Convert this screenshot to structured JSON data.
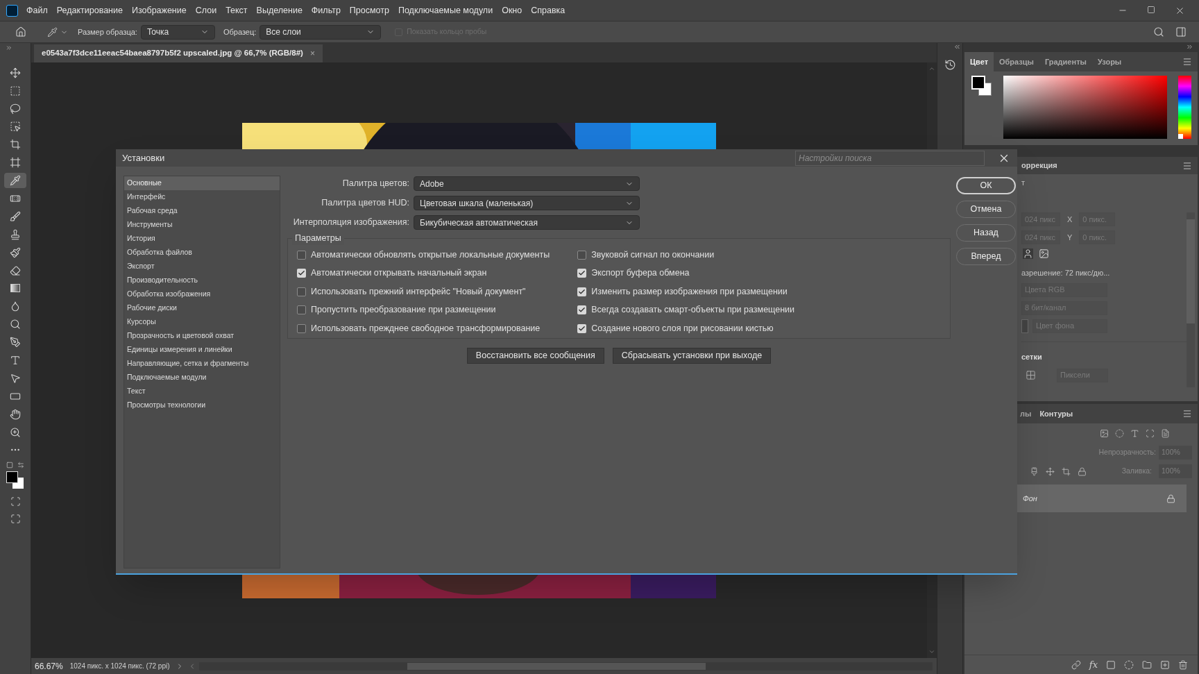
{
  "menu_bar": {
    "items": [
      "Файл",
      "Редактирование",
      "Изображение",
      "Слои",
      "Текст",
      "Выделение",
      "Фильтр",
      "Просмотр",
      "Подключаемые модули",
      "Окно",
      "Справка"
    ]
  },
  "options_bar": {
    "sample_size_label": "Размер образца:",
    "sample_size": "Точка",
    "sample_label": "Образец:",
    "sample": "Все слои",
    "show_ring": {
      "label": "Показать кольцо пробы",
      "checked": false,
      "disabled": true
    }
  },
  "tools": [
    {
      "kind": "move",
      "selected": false
    },
    {
      "kind": "marquee",
      "selected": false
    },
    {
      "kind": "lasso",
      "selected": false
    },
    {
      "kind": "object_select",
      "selected": false
    },
    {
      "kind": "crop",
      "selected": false
    },
    {
      "kind": "frame",
      "selected": false
    },
    {
      "kind": "eyedropper",
      "selected": true
    },
    {
      "kind": "healing",
      "selected": false
    },
    {
      "kind": "brush",
      "selected": false
    },
    {
      "kind": "stamp",
      "selected": false
    },
    {
      "kind": "history_brush",
      "selected": false
    },
    {
      "kind": "eraser",
      "selected": false
    },
    {
      "kind": "gradient",
      "selected": false
    },
    {
      "kind": "blur",
      "selected": false
    },
    {
      "kind": "dodge",
      "selected": false
    },
    {
      "kind": "pen",
      "selected": false
    },
    {
      "kind": "type",
      "selected": false
    },
    {
      "kind": "path_select",
      "selected": false
    },
    {
      "kind": "shape",
      "selected": false
    },
    {
      "kind": "hand",
      "selected": false
    },
    {
      "kind": "zoom",
      "selected": false
    },
    {
      "kind": "more",
      "selected": false
    }
  ],
  "document": {
    "tab_title": "e0543a7f3dce11eeac54baea8797b5f2 upscaled.jpg @ 66,7% (RGB/8#)",
    "close": "×",
    "zoom": "66.67%",
    "info": "1024 пикс. x 1024 пикс. (72 ppi)"
  },
  "panels": {
    "color": {
      "hue": {
        "level": 0
      },
      "tabs": [
        {
          "label": "Цвет",
          "selected": true
        },
        {
          "label": "Образцы",
          "selected": false
        },
        {
          "label": "Градиенты",
          "selected": false
        },
        {
          "label": "Узоры",
          "selected": false
        }
      ]
    },
    "properties": {
      "tab": "оррекция",
      "section": "т",
      "width": "024 пикс",
      "x_label": "X",
      "x": "0 пикс.",
      "height": "024 пикс",
      "y_label": "Y",
      "y": "0 пикс.",
      "resolution": "азрешение: 72 пикс/дю...",
      "mode": "Цвета RGB",
      "depth": "8 бит/канал",
      "background": "Цвет фона",
      "grid_heading": "сетки",
      "grid_units": "Пиксели"
    },
    "layers": {
      "tabs": [
        "лы",
        "Контуры"
      ],
      "opacity_label": "Непрозрачность:",
      "opacity": "100%",
      "fill_label": "Заливка:",
      "fill": "100%",
      "effects": "fx",
      "items": [
        {
          "name": "Фон",
          "locked": true,
          "selected": true
        }
      ]
    }
  },
  "dialog": {
    "title": "Установки",
    "search_placeholder": "Настройки поиска",
    "categories": [
      {
        "label": "Основные",
        "selected": true
      },
      {
        "label": "Интерфейс",
        "selected": false
      },
      {
        "label": "Рабочая среда",
        "selected": false
      },
      {
        "label": "Инструменты",
        "selected": false
      },
      {
        "label": "История",
        "selected": false
      },
      {
        "label": "Обработка файлов",
        "selected": false
      },
      {
        "label": "Экспорт",
        "selected": false
      },
      {
        "label": "Производительность",
        "selected": false
      },
      {
        "label": "Обработка изображения",
        "selected": false
      },
      {
        "label": "Рабочие диски",
        "selected": false
      },
      {
        "label": "Курсоры",
        "selected": false
      },
      {
        "label": "Прозрачность и цветовой охват",
        "selected": false
      },
      {
        "label": "Единицы измерения и линейки",
        "selected": false
      },
      {
        "label": "Направляющие, сетка и фрагменты",
        "selected": false
      },
      {
        "label": "Подключаемые модули",
        "selected": false
      },
      {
        "label": "Текст",
        "selected": false
      },
      {
        "label": "Просмотры технологии",
        "selected": false
      }
    ],
    "fields": [
      {
        "label": "Палитра цветов:",
        "value": "Adobe"
      },
      {
        "label": "Палитра цветов HUD:",
        "value": "Цветовая шкала (маленькая)"
      },
      {
        "label": "Интерполяция изображения:",
        "value": "Бикубическая автоматическая"
      }
    ],
    "group_title": "Параметры",
    "options": [
      {
        "label": "Автоматически обновлять открытые локальные документы",
        "checked": false
      },
      {
        "label": "Автоматически открывать начальный экран",
        "checked": true
      },
      {
        "label": "Использовать прежний интерфейс \"Новый документ\"",
        "checked": false
      },
      {
        "label": "Пропустить преобразование при размещении",
        "checked": false
      },
      {
        "label": "Использовать прежднее свободное трансформирование",
        "checked": false
      },
      {
        "label": "Звуковой сигнал по окончании",
        "checked": false
      },
      {
        "label": "Экспорт буфера обмена",
        "checked": true
      },
      {
        "label": "Изменить размер изображения при размещении",
        "checked": true
      },
      {
        "label": "Всегда создавать смарт-объекты при размещении",
        "checked": true
      },
      {
        "label": "Создание нового слоя при рисовании кистью",
        "checked": true
      }
    ],
    "actions": [
      "Восстановить все сообщения",
      "Сбрасывать установки при выходе"
    ],
    "buttons": [
      {
        "label": "ОК",
        "primary": true
      },
      {
        "label": "Отмена",
        "primary": false
      },
      {
        "label": "Назад",
        "primary": false
      },
      {
        "label": "Вперед",
        "primary": false
      }
    ]
  }
}
